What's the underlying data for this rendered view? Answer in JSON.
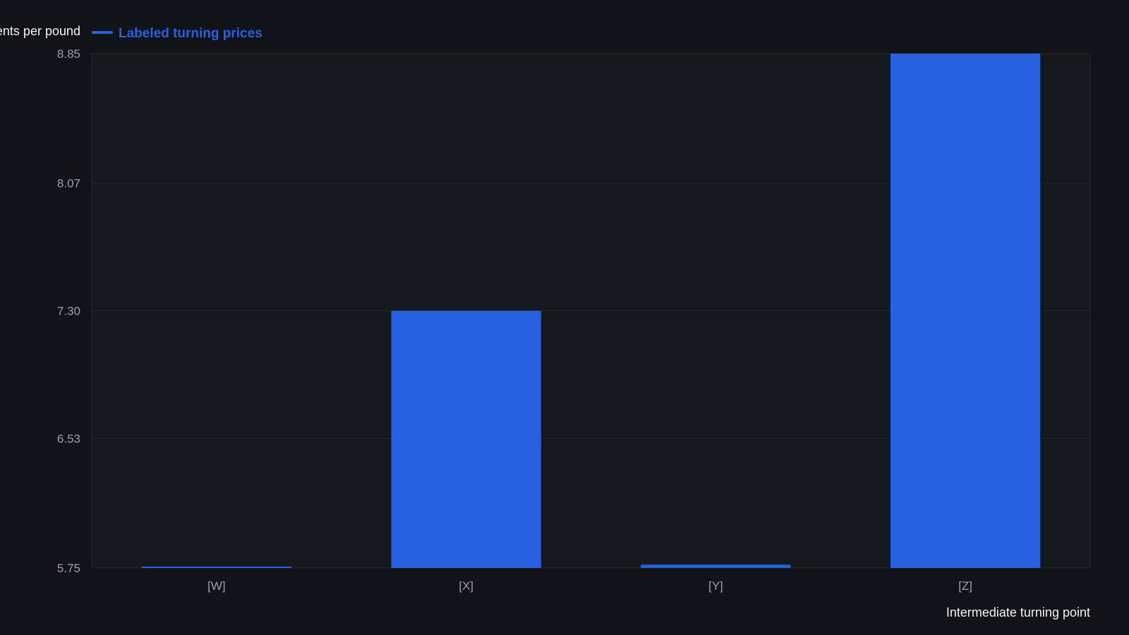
{
  "chart_data": {
    "type": "bar",
    "title": "",
    "xlabel": "Intermediate turning point",
    "ylabel": "Cents per pound",
    "categories": [
      "[W]",
      "[X]",
      "[Y]",
      "[Z]"
    ],
    "series": [
      {
        "name": "Labeled turning prices",
        "values": [
          5.755,
          7.3,
          5.77,
          8.85
        ]
      }
    ],
    "ylim": [
      5.75,
      8.85
    ],
    "yticks": [
      "5.75",
      "6.53",
      "7.30",
      "8.07",
      "8.85"
    ],
    "grid": true,
    "legend": "top-left",
    "colors": {
      "bar": "#2760e0",
      "background": "#111318",
      "plot_background": "#15181d",
      "grid": "#262a31",
      "text": "#9aa0a8",
      "title_text": "#f2f3f5"
    }
  }
}
